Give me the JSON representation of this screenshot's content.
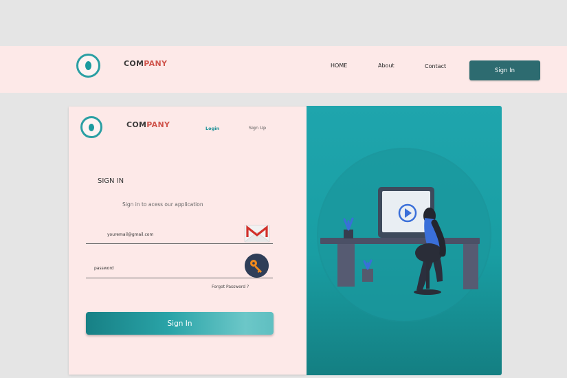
{
  "navbar": {
    "brand_prefix": "COM",
    "brand_suffix": "PANY",
    "links": [
      "HOME",
      "About",
      "Contact"
    ],
    "signin_label": "Sign In"
  },
  "card": {
    "brand_prefix": "COM",
    "brand_suffix": "PANY",
    "tab_login": "Login",
    "tab_signup": "Sign Up",
    "title": "SIGN IN",
    "subtitle": "Sign in to acess our application",
    "email_placeholder": "youremail@gmail.com",
    "password_placeholder": "password",
    "forgot_label": "Forgot Password ?",
    "submit_label": "Sign In"
  },
  "colors": {
    "accent": "#1a9a9e",
    "brand_accent": "#d0554d",
    "nav_button": "#2d6b70",
    "panel_bg": "#fde9e8",
    "illustration_bg": "#1fa5ad"
  },
  "icons": [
    "logo-icon",
    "gmail-icon",
    "key-icon",
    "woman-at-desk-illustration"
  ]
}
